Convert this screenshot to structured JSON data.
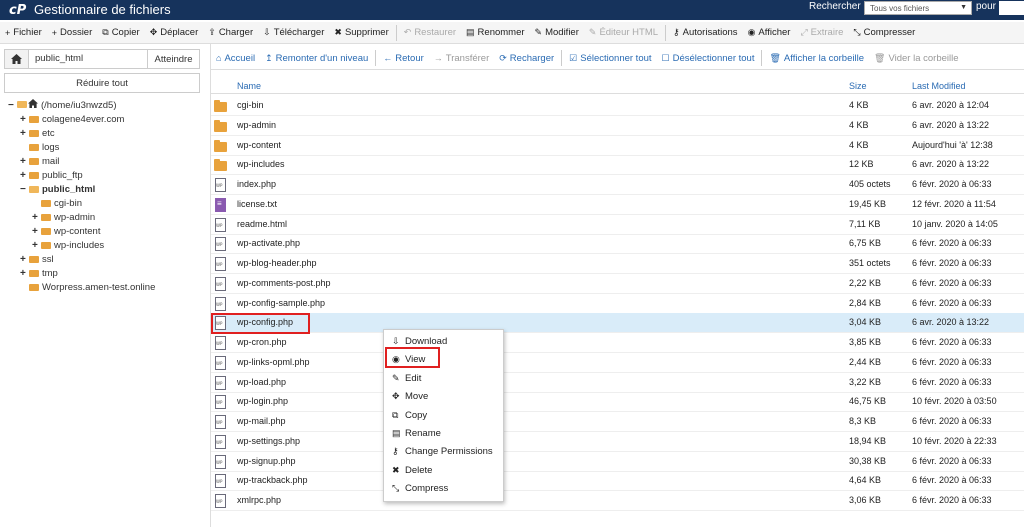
{
  "header": {
    "logo": "cP",
    "title": "Gestionnaire de fichiers",
    "search_label": "Rechercher",
    "search_scope": "Tous vos fichiers",
    "search_for_label": "pour"
  },
  "toolbar": [
    {
      "label": "Fichier",
      "icon": "plus-icon",
      "glyph": "+",
      "disabled": false
    },
    {
      "label": "Dossier",
      "icon": "plus-icon",
      "glyph": "+",
      "disabled": false
    },
    {
      "label": "Copier",
      "icon": "copy-icon",
      "glyph": "⧉",
      "disabled": false
    },
    {
      "label": "Déplacer",
      "icon": "move-icon",
      "glyph": "✥",
      "disabled": false
    },
    {
      "label": "Charger",
      "icon": "upload-icon",
      "glyph": "⇪",
      "disabled": false
    },
    {
      "label": "Télécharger",
      "icon": "download-icon",
      "glyph": "⇩",
      "disabled": false
    },
    {
      "label": "Supprimer",
      "icon": "delete-icon",
      "glyph": "✖",
      "disabled": false
    },
    {
      "label": "Restaurer",
      "icon": "restore-icon",
      "glyph": "↶",
      "disabled": true
    },
    {
      "label": "Renommer",
      "icon": "rename-icon",
      "glyph": "▤",
      "disabled": false
    },
    {
      "label": "Modifier",
      "icon": "edit-icon",
      "glyph": "✎",
      "disabled": false
    },
    {
      "label": "Éditeur HTML",
      "icon": "html-editor-icon",
      "glyph": "✎",
      "disabled": true
    },
    {
      "label": "Autorisations",
      "icon": "key-icon",
      "glyph": "⚷",
      "disabled": false
    },
    {
      "label": "Afficher",
      "icon": "eye-icon",
      "glyph": "◉",
      "disabled": false
    },
    {
      "label": "Extraire",
      "icon": "extract-icon",
      "glyph": "⤢",
      "disabled": true
    },
    {
      "label": "Compresser",
      "icon": "compress-icon",
      "glyph": "⤡",
      "disabled": false
    }
  ],
  "sidebar": {
    "path_value": "public_html",
    "go_label": "Atteindre",
    "collapse_label": "Réduire tout",
    "tree": [
      {
        "label": "(/home/iu3nwzd5)",
        "pm": "−",
        "type": "home",
        "open": true,
        "bold": false
      },
      {
        "label": "colagene4ever.com",
        "pm": "+",
        "type": "folder",
        "open": false,
        "bold": false
      },
      {
        "label": "etc",
        "pm": "+",
        "type": "folder",
        "open": false,
        "bold": false
      },
      {
        "label": "logs",
        "pm": "",
        "type": "folder",
        "open": false,
        "bold": false
      },
      {
        "label": "mail",
        "pm": "+",
        "type": "folder",
        "open": false,
        "bold": false
      },
      {
        "label": "public_ftp",
        "pm": "+",
        "type": "folder",
        "open": false,
        "bold": false
      },
      {
        "label": "public_html",
        "pm": "−",
        "type": "folder",
        "open": true,
        "bold": true
      },
      {
        "label": "cgi-bin",
        "pm": "",
        "type": "folder",
        "open": false,
        "bold": false
      },
      {
        "label": "wp-admin",
        "pm": "+",
        "type": "folder",
        "open": false,
        "bold": false
      },
      {
        "label": "wp-content",
        "pm": "+",
        "type": "folder",
        "open": false,
        "bold": false
      },
      {
        "label": "wp-includes",
        "pm": "+",
        "type": "folder",
        "open": false,
        "bold": false
      },
      {
        "label": "ssl",
        "pm": "+",
        "type": "folder",
        "open": false,
        "bold": false
      },
      {
        "label": "tmp",
        "pm": "+",
        "type": "folder",
        "open": false,
        "bold": false
      },
      {
        "label": "Worpress.amen-test.online",
        "pm": "",
        "type": "folder",
        "open": false,
        "bold": false
      }
    ]
  },
  "navbar": [
    {
      "label": "Accueil",
      "icon": "home-icon",
      "glyph": "⌂",
      "disabled": false
    },
    {
      "label": "Remonter d'un niveau",
      "icon": "level-up-icon",
      "glyph": "↥",
      "disabled": false
    },
    {
      "label": "Retour",
      "icon": "back-arrow-icon",
      "glyph": "←",
      "disabled": false
    },
    {
      "label": "Transférer",
      "icon": "forward-arrow-icon",
      "glyph": "→",
      "disabled": true
    },
    {
      "label": "Recharger",
      "icon": "reload-icon",
      "glyph": "⟳",
      "disabled": false
    },
    {
      "label": "Sélectionner tout",
      "icon": "checkbox-checked-icon",
      "glyph": "☑",
      "disabled": false
    },
    {
      "label": "Désélectionner tout",
      "icon": "checkbox-empty-icon",
      "glyph": "☐",
      "disabled": false
    },
    {
      "label": "Afficher la corbeille",
      "icon": "trash-icon",
      "glyph": "🗑",
      "disabled": false
    },
    {
      "label": "Vider la corbeille",
      "icon": "trash-icon",
      "glyph": "🗑",
      "disabled": true
    }
  ],
  "table": {
    "headers": {
      "name": "Name",
      "size": "Size",
      "modified": "Last Modified"
    },
    "rows": [
      {
        "name": "cgi-bin",
        "size": "4 KB",
        "date": "6 avr. 2020 à 12:04",
        "type": "folder"
      },
      {
        "name": "wp-admin",
        "size": "4 KB",
        "date": "6 avr. 2020 à 13:22",
        "type": "folder"
      },
      {
        "name": "wp-content",
        "size": "4 KB",
        "date": "Aujourd'hui 'à' 12:38",
        "type": "folder"
      },
      {
        "name": "wp-includes",
        "size": "12 KB",
        "date": "6 avr. 2020 à 13:22",
        "type": "folder"
      },
      {
        "name": "index.php",
        "size": "405 octets",
        "date": "6 févr. 2020 à 06:33",
        "type": "php"
      },
      {
        "name": "license.txt",
        "size": "19,45 KB",
        "date": "12 févr. 2020 à 11:54",
        "type": "txt"
      },
      {
        "name": "readme.html",
        "size": "7,11 KB",
        "date": "10 janv. 2020 à 14:05",
        "type": "php"
      },
      {
        "name": "wp-activate.php",
        "size": "6,75 KB",
        "date": "6 févr. 2020 à 06:33",
        "type": "php"
      },
      {
        "name": "wp-blog-header.php",
        "size": "351 octets",
        "date": "6 févr. 2020 à 06:33",
        "type": "php"
      },
      {
        "name": "wp-comments-post.php",
        "size": "2,22 KB",
        "date": "6 févr. 2020 à 06:33",
        "type": "php"
      },
      {
        "name": "wp-config-sample.php",
        "size": "2,84 KB",
        "date": "6 févr. 2020 à 06:33",
        "type": "php"
      },
      {
        "name": "wp-config.php",
        "size": "3,04 KB",
        "date": "6 avr. 2020 à 13:22",
        "type": "php",
        "selected": true
      },
      {
        "name": "wp-cron.php",
        "size": "3,85 KB",
        "date": "6 févr. 2020 à 06:33",
        "type": "php"
      },
      {
        "name": "wp-links-opml.php",
        "size": "2,44 KB",
        "date": "6 févr. 2020 à 06:33",
        "type": "php"
      },
      {
        "name": "wp-load.php",
        "size": "3,22 KB",
        "date": "6 févr. 2020 à 06:33",
        "type": "php"
      },
      {
        "name": "wp-login.php",
        "size": "46,75 KB",
        "date": "10 févr. 2020 à 03:50",
        "type": "php"
      },
      {
        "name": "wp-mail.php",
        "size": "8,3 KB",
        "date": "6 févr. 2020 à 06:33",
        "type": "php"
      },
      {
        "name": "wp-settings.php",
        "size": "18,94 KB",
        "date": "10 févr. 2020 à 22:33",
        "type": "php"
      },
      {
        "name": "wp-signup.php",
        "size": "30,38 KB",
        "date": "6 févr. 2020 à 06:33",
        "type": "php"
      },
      {
        "name": "wp-trackback.php",
        "size": "4,64 KB",
        "date": "6 févr. 2020 à 06:33",
        "type": "php"
      },
      {
        "name": "xmlrpc.php",
        "size": "3,06 KB",
        "date": "6 févr. 2020 à 06:33",
        "type": "php"
      }
    ]
  },
  "context_menu": [
    {
      "label": "Download",
      "icon": "download-icon",
      "glyph": "⇩"
    },
    {
      "label": "View",
      "icon": "eye-icon",
      "glyph": "◉"
    },
    {
      "label": "Edit",
      "icon": "edit-icon",
      "glyph": "✎"
    },
    {
      "label": "Move",
      "icon": "move-icon",
      "glyph": "✥"
    },
    {
      "label": "Copy",
      "icon": "copy-icon",
      "glyph": "⧉"
    },
    {
      "label": "Rename",
      "icon": "rename-icon",
      "glyph": "▤"
    },
    {
      "label": "Change Permissions",
      "icon": "key-icon",
      "glyph": "⚷"
    },
    {
      "label": "Delete",
      "icon": "delete-icon",
      "glyph": "✖"
    },
    {
      "label": "Compress",
      "icon": "compress-icon",
      "glyph": "⤡"
    }
  ],
  "colors": {
    "header_bg": "#16335c",
    "link_blue": "#2a6bb3",
    "selected_row": "#d9ecf9",
    "folder": "#e8a23c",
    "highlight_red": "#e02020"
  }
}
